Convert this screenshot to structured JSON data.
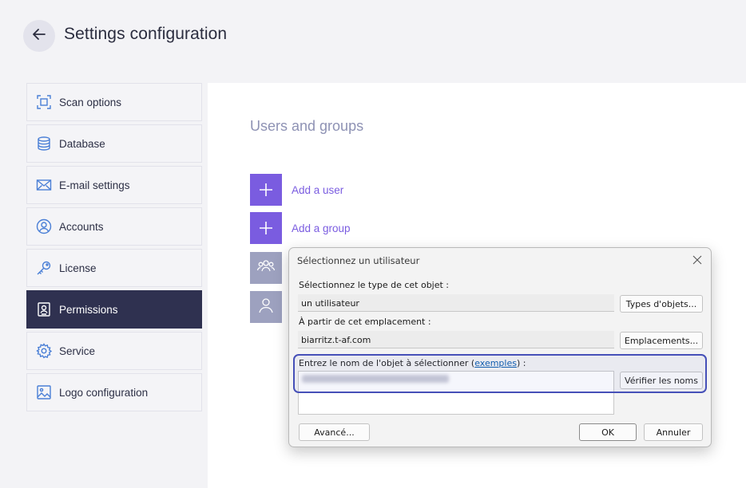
{
  "header": {
    "title": "Settings configuration",
    "back_icon": "arrow-left-icon"
  },
  "sidebar": {
    "active_color": "#2f3150",
    "items": [
      {
        "label": "Scan options",
        "icon": "scan-icon"
      },
      {
        "label": "Database",
        "icon": "database-icon"
      },
      {
        "label": "E-mail settings",
        "icon": "mail-icon"
      },
      {
        "label": "Accounts",
        "icon": "user-circle-icon"
      },
      {
        "label": "License",
        "icon": "key-icon"
      },
      {
        "label": "Permissions",
        "icon": "badge-icon",
        "active": true
      },
      {
        "label": "Service",
        "icon": "gear-icon"
      },
      {
        "label": "Logo configuration",
        "icon": "image-icon"
      }
    ]
  },
  "main": {
    "section_title": "Users and groups",
    "accent_color": "#7a5ce0",
    "add_user_label": "Add a user",
    "add_group_label": "Add a group"
  },
  "dialog": {
    "title": "Sélectionnez un utilisateur",
    "object_type_label": "Sélectionnez le type de cet objet :",
    "object_type_value": "un utilisateur",
    "object_types_button": "Types d'objets...",
    "location_label": "À partir de cet emplacement :",
    "location_value": "biarritz.t-af.com",
    "locations_button": "Emplacements...",
    "name_label_prefix": "Entrez le nom de l'objet à sélectionner (",
    "name_label_link": "exemples",
    "name_label_suffix": ") :",
    "check_names_button": "Vérifier les noms",
    "advanced_button": "Avancé...",
    "ok_button": "OK",
    "cancel_button": "Annuler"
  }
}
